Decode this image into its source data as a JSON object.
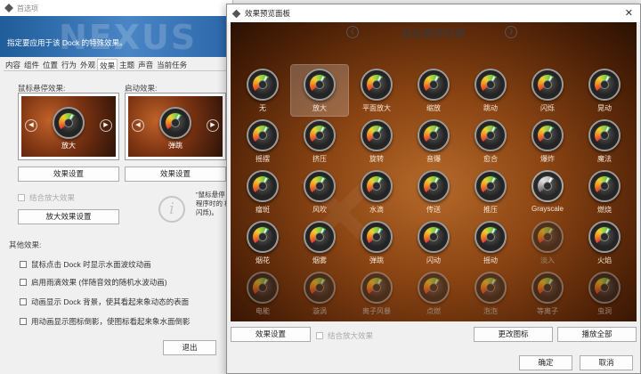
{
  "prefs": {
    "title": "首选项",
    "banner_text": "指定要应用于该 Dock 的特殊效果。",
    "banner_watermark": "NEXUS",
    "tabs": [
      {
        "label": "内容"
      },
      {
        "label": "组件"
      },
      {
        "label": "位置"
      },
      {
        "label": "行为"
      },
      {
        "label": "外观"
      },
      {
        "label": "效果",
        "active": true
      },
      {
        "label": "主题"
      },
      {
        "label": "声音"
      },
      {
        "label": "当前任务"
      }
    ],
    "hover_effect_label": "鼠标悬停效果:",
    "launch_effect_label": "启动效果:",
    "hover_preview_caption": "放大",
    "launch_preview_caption": "弹跳",
    "hover_settings_button": "效果设置",
    "launch_settings_button": "效果设置",
    "combine_zoom_label": "结合放大效果",
    "zoom_settings_button": "放大效果设置",
    "hover_note": "\"鼠标悬停\n程序时的\n标闪烁)。",
    "other_effects_label": "其他效果:",
    "other_effects": [
      "鼠标点击 Dock 时显示水面波纹动画",
      "启用雨滴效果 (伴随音效的随机水波动画)",
      "动画显示 Dock 背景，使其看起来象动态的表面",
      "用动画显示图标倒影，使图标看起来象水面倒影"
    ],
    "exit_button": "退出"
  },
  "dialog": {
    "title": "效果预览面板",
    "close_glyph": "✕",
    "heading": "鼠标悬停效果",
    "selected_index": 1,
    "effects": [
      "无",
      "放大",
      "平面放大",
      "缩放",
      "跳动",
      "闪烁",
      "晃动",
      "摇摆",
      "挤压",
      "旋转",
      "音爆",
      "愈合",
      "爆炸",
      "魔法",
      "瘤斑",
      "风吹",
      "水滴",
      "传送",
      "推压",
      "Grayscale",
      "燃烧",
      "烟花",
      "烟雾",
      "弹跳",
      "闪动",
      "摇动",
      "淡入",
      "火焰",
      "电能",
      "漩涡",
      "离子风暴",
      "点燃",
      "泡泡",
      "等离子",
      "虫洞"
    ],
    "effects_settings_button": "效果设置",
    "combine_zoom_label": "结合放大效果",
    "change_icon_button": "更改图标",
    "play_all_button": "播放全部",
    "ok_button": "确定",
    "cancel_button": "取消",
    "prev_glyph": "❮",
    "next_glyph": "❯"
  }
}
